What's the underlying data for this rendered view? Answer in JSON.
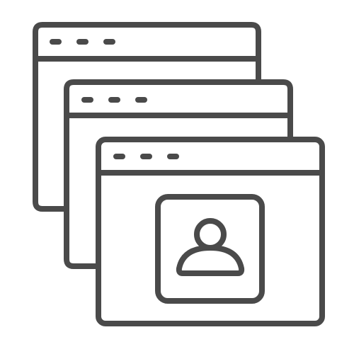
{
  "icon": {
    "name": "stacked-browser-windows-with-user-profile-icon",
    "stroke_color": "#4a4a4a",
    "background_color": "#ffffff",
    "window_count": 3,
    "front_window_content_icon": "user-profile-icon"
  }
}
